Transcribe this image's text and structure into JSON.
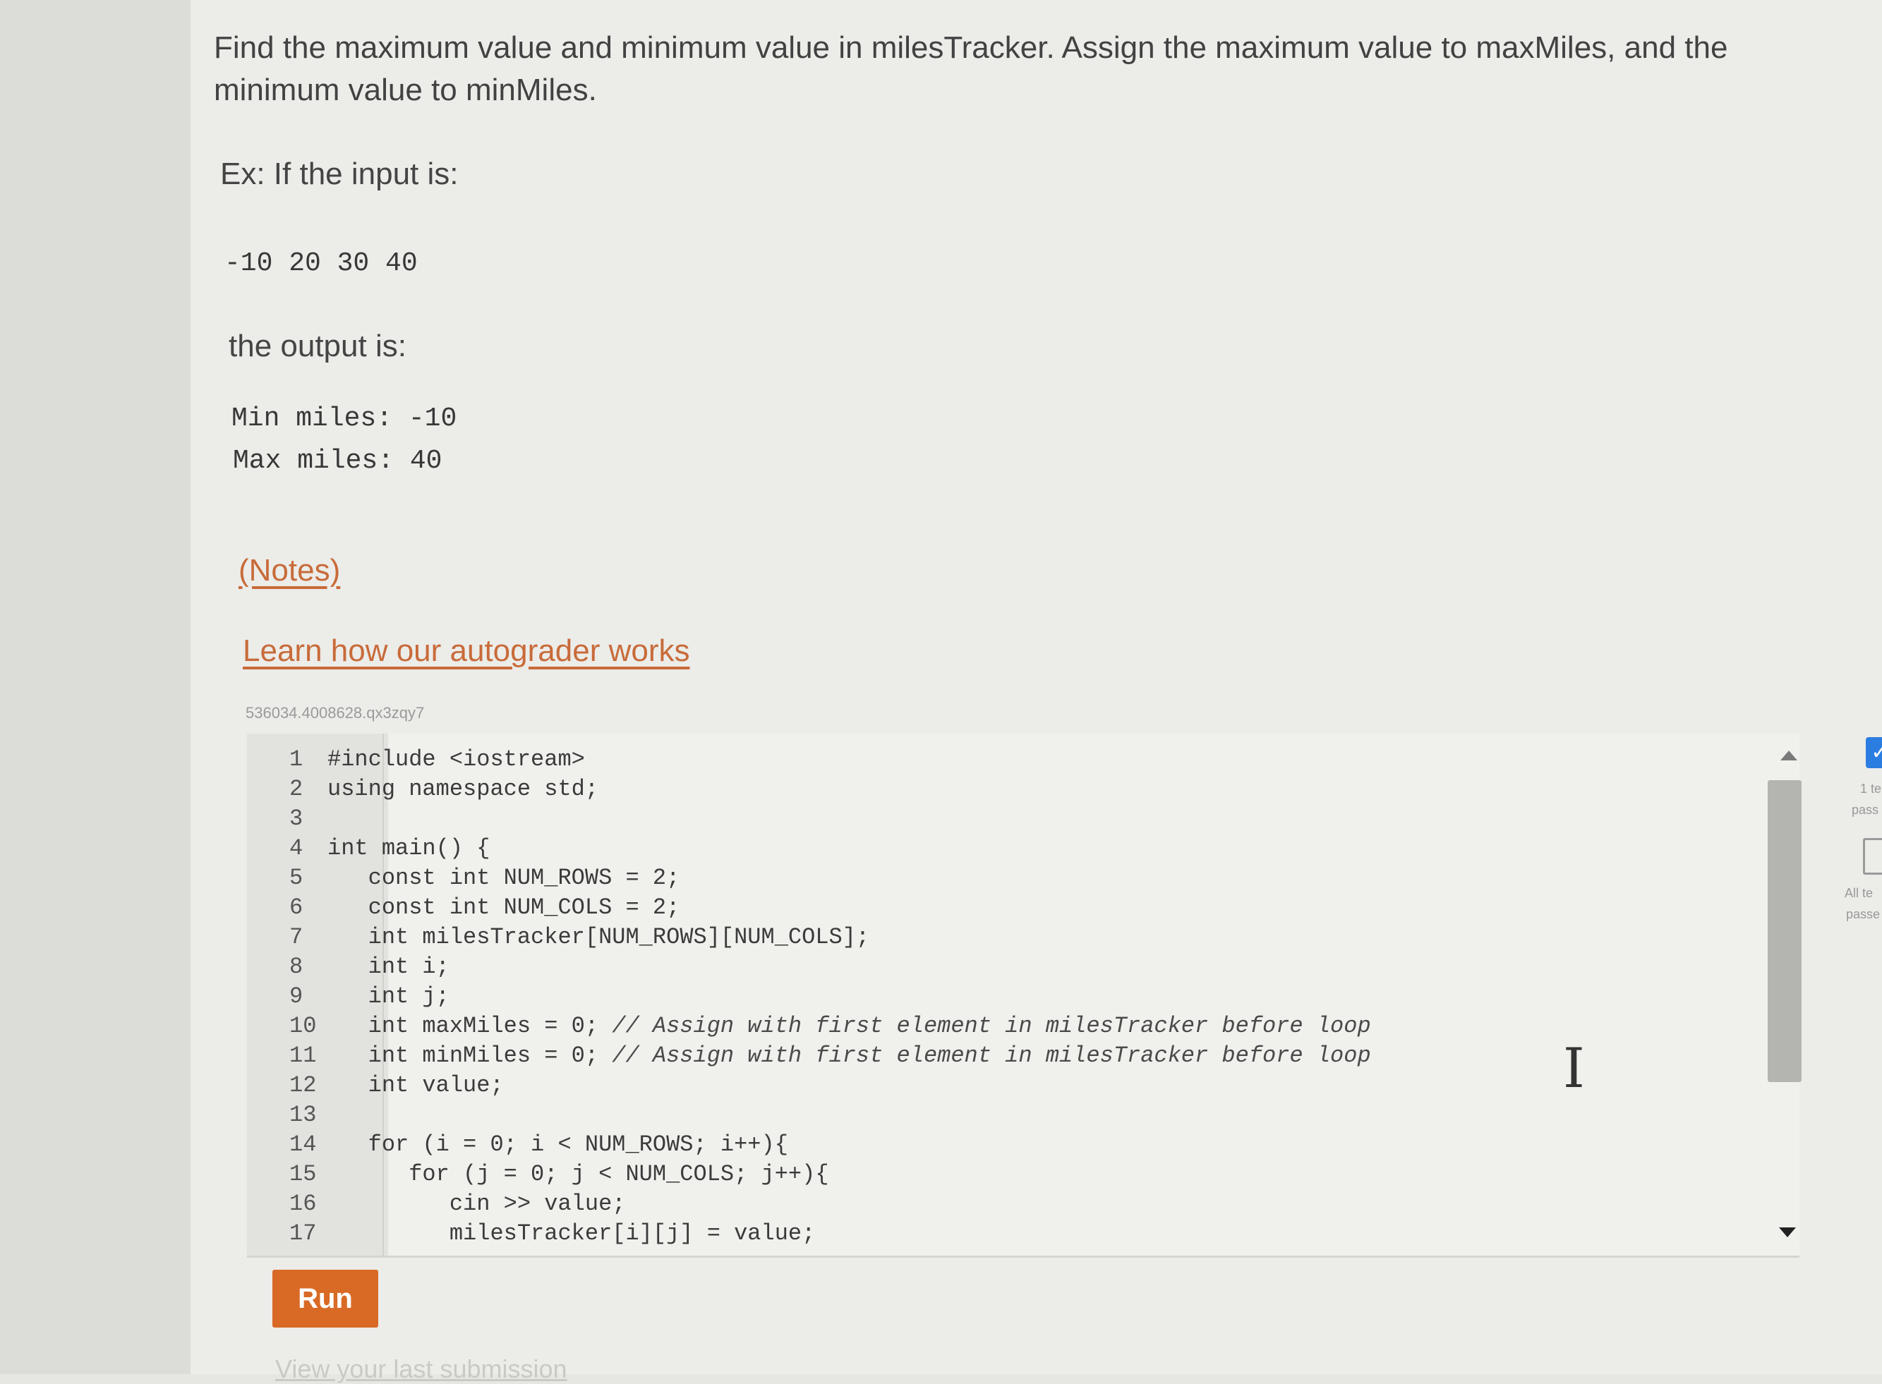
{
  "prompt": {
    "text": "Find the maximum value and minimum value in milesTracker. Assign the maximum value to maxMiles, and the minimum value to minMiles."
  },
  "example": {
    "input_label": "Ex: If the input is:",
    "input_value": "-10 20 30 40",
    "output_label": "the output is:",
    "output_lines": [
      "Min miles: -10",
      "Max miles: 40"
    ]
  },
  "links": {
    "notes": "(Notes)",
    "autograder": "Learn how our autograder works"
  },
  "lab_id": "536034.4008628.qx3zqy7",
  "editor": {
    "lines": [
      {
        "num": "1",
        "code": "#include <iostream>"
      },
      {
        "num": "2",
        "code": "using namespace std;"
      },
      {
        "num": "3",
        "code": ""
      },
      {
        "num": "4",
        "code": "int main() {"
      },
      {
        "num": "5",
        "code": "   const int NUM_ROWS = 2;"
      },
      {
        "num": "6",
        "code": "   const int NUM_COLS = 2;"
      },
      {
        "num": "7",
        "code": "   int milesTracker[NUM_ROWS][NUM_COLS];"
      },
      {
        "num": "8",
        "code": "   int i;"
      },
      {
        "num": "9",
        "code": "   int j;"
      },
      {
        "num": "10",
        "code": "   int maxMiles = 0; ",
        "comment": "// Assign with first element in milesTracker before loop"
      },
      {
        "num": "11",
        "code": "   int minMiles = 0; ",
        "comment": "// Assign with first element in milesTracker before loop"
      },
      {
        "num": "12",
        "code": "   int value;"
      },
      {
        "num": "13",
        "code": ""
      },
      {
        "num": "14",
        "code": "   for (i = 0; i < NUM_ROWS; i++){"
      },
      {
        "num": "15",
        "code": "      for (j = 0; j < NUM_COLS; j++){"
      },
      {
        "num": "16",
        "code": "         cin >> value;"
      },
      {
        "num": "17",
        "code": "         milesTracker[i][j] = value;"
      }
    ]
  },
  "run_button": "Run",
  "submission_link": "View your last submission",
  "side_panel": {
    "test1_a": "1 te",
    "test1_b": "pass",
    "test2_a": "All te",
    "test2_b": "passe"
  },
  "icons": {
    "check": "check-icon",
    "scroll_up": "chevron-up-icon",
    "scroll_down": "chevron-down-icon",
    "text_cursor": "text-cursor-icon"
  },
  "colors": {
    "accent": "#d96a25",
    "link": "#c86b3a",
    "check": "#2b7de1"
  }
}
